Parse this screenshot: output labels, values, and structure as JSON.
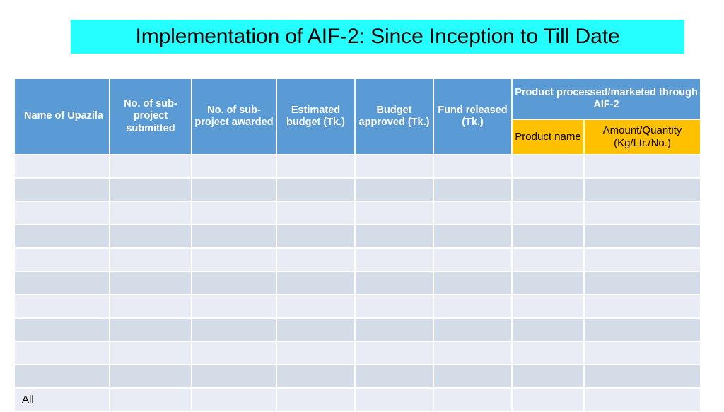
{
  "slide": {
    "title": "Implementation of AIF-2: Since Inception to Till Date",
    "banner_color": "#26FFFF",
    "header_color": "#5B9BD5",
    "subheader_color": "#FFC000",
    "row_color_odd": "#E9EBF5",
    "row_color_even": "#D4DCE8"
  },
  "table": {
    "headers": {
      "upazila": "Name of Upazila",
      "sub_project_submitted": "No. of sub-project submitted",
      "sub_project_awarded": "No. of sub-project awarded",
      "estimated_budget": "Estimated budget (Tk.)",
      "budget_approved": "Budget approved (Tk.)",
      "fund_released": "Fund released (Tk.)",
      "product_group": "Product processed/marketed through  AIF-2",
      "product_name": "Product name",
      "product_amount": "Amount/Quantity (Kg/Ltr./No.)"
    },
    "rows": [
      {
        "upazila": "",
        "submitted": "",
        "awarded": "",
        "estimated": "",
        "approved": "",
        "released": "",
        "product_name": "",
        "product_amount": ""
      },
      {
        "upazila": "",
        "submitted": "",
        "awarded": "",
        "estimated": "",
        "approved": "",
        "released": "",
        "product_name": "",
        "product_amount": ""
      },
      {
        "upazila": "",
        "submitted": "",
        "awarded": "",
        "estimated": "",
        "approved": "",
        "released": "",
        "product_name": "",
        "product_amount": ""
      },
      {
        "upazila": "",
        "submitted": "",
        "awarded": "",
        "estimated": "",
        "approved": "",
        "released": "",
        "product_name": "",
        "product_amount": ""
      },
      {
        "upazila": "",
        "submitted": "",
        "awarded": "",
        "estimated": "",
        "approved": "",
        "released": "",
        "product_name": "",
        "product_amount": ""
      },
      {
        "upazila": "",
        "submitted": "",
        "awarded": "",
        "estimated": "",
        "approved": "",
        "released": "",
        "product_name": "",
        "product_amount": ""
      },
      {
        "upazila": "",
        "submitted": "",
        "awarded": "",
        "estimated": "",
        "approved": "",
        "released": "",
        "product_name": "",
        "product_amount": ""
      },
      {
        "upazila": "",
        "submitted": "",
        "awarded": "",
        "estimated": "",
        "approved": "",
        "released": "",
        "product_name": "",
        "product_amount": ""
      },
      {
        "upazila": "",
        "submitted": "",
        "awarded": "",
        "estimated": "",
        "approved": "",
        "released": "",
        "product_name": "",
        "product_amount": ""
      },
      {
        "upazila": "",
        "submitted": "",
        "awarded": "",
        "estimated": "",
        "approved": "",
        "released": "",
        "product_name": "",
        "product_amount": ""
      },
      {
        "upazila": "All",
        "submitted": "",
        "awarded": "",
        "estimated": "",
        "approved": "",
        "released": "",
        "product_name": "",
        "product_amount": ""
      }
    ]
  }
}
